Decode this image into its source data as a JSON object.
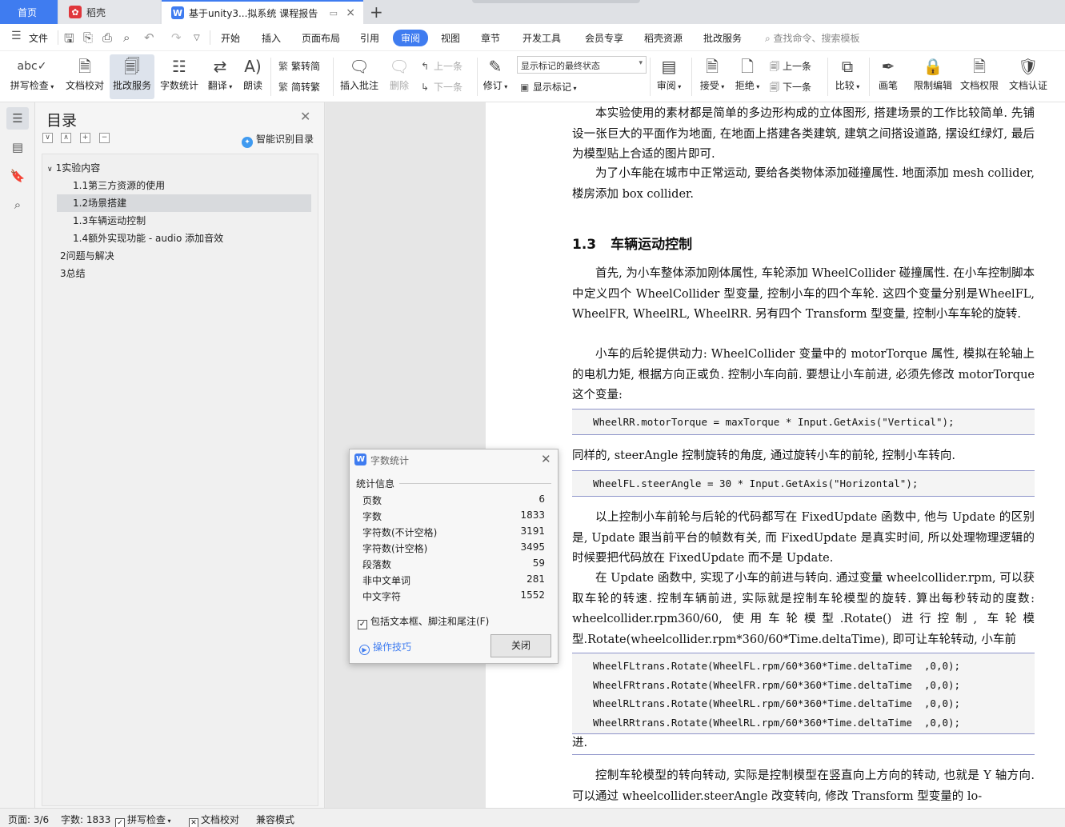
{
  "tabs": {
    "home": "首页",
    "daoke": "稻壳",
    "doc": "基于unity3...拟系统 课程报告",
    "doc_icon": "W",
    "close": "×",
    "new": "+"
  },
  "menu": {
    "file": "文件",
    "items": [
      "开始",
      "插入",
      "页面布局",
      "引用",
      "审阅",
      "视图",
      "章节",
      "开发工具",
      "会员专享",
      "稻壳资源",
      "批改服务"
    ],
    "search_placeholder": "查找命令、搜索模板"
  },
  "ribbon": {
    "spellcheck": "拼写检查",
    "doc_proof": "文档校对",
    "correction": "批改服务",
    "word_count": "字数统计",
    "translate": "翻译",
    "read_aloud": "朗读",
    "trad_to_simp": "繁转简",
    "simp_to_trad": "简转繁",
    "insert_comment": "插入批注",
    "delete": "删除",
    "prev": "上一条",
    "next": "下一条",
    "revise": "修订",
    "markup_select": "显示标记的最终状态",
    "show_markup": "显示标记",
    "review": "审阅",
    "accept": "接受",
    "reject": "拒绝",
    "prev2": "上一条",
    "next2": "下一条",
    "compare": "比较",
    "pen": "画笔",
    "restrict_edit": "限制编辑",
    "doc_rights": "文档权限",
    "doc_auth": "文档认证"
  },
  "toc": {
    "title": "目录",
    "smart": "智能识别目录",
    "items": [
      {
        "label": "1实验内容",
        "expander": "∨"
      },
      {
        "label": "1.1第三方资源的使用"
      },
      {
        "label": "1.2场景搭建"
      },
      {
        "label": "1.3车辆运动控制"
      },
      {
        "label": "1.4额外实现功能 - audio 添加音效"
      },
      {
        "label": "2问题与解决"
      },
      {
        "label": "3总结"
      }
    ]
  },
  "document": {
    "p1": "本实验使用的素材都是简单的多边形构成的立体图形, 搭建场景的工作比较简单. 先铺设一张巨大的平面作为地面, 在地面上搭建各类建筑, 建筑之间搭设道路, 摆设红绿灯, 最后为模型贴上合适的图片即可.",
    "p2": "为了小车能在城市中正常运动, 要给各类物体添加碰撞属性. 地面添加 mesh collider, 楼房添加 box collider.",
    "h13_num": "1.3",
    "h13_text": "车辆运动控制",
    "p3": "首先, 为小车整体添加刚体属性, 车轮添加 WheelCollider 碰撞属性. 在小车控制脚本中定义四个 WheelCollider 型变量, 控制小车的四个车轮. 这四个变量分别是WheelFL, WheelFR, WheelRL, WheelRR. 另有四个 Transform 型变量, 控制小车车轮的旋转.",
    "p4": "小车的后轮提供动力: WheelCollider 变量中的 motorTorque 属性, 模拟在轮轴上的电机力矩, 根据方向正或负. 控制小车向前. 要想让小车前进, 必须先修改 motorTorque 这个变量:",
    "code1": "WheelRR.motorTorque = maxTorque * Input.GetAxis(\"Vertical\");",
    "p5": "同样的, steerAngle 控制旋转的角度, 通过旋转小车的前轮, 控制小车转向.",
    "code2": "WheelFL.steerAngle = 30 * Input.GetAxis(\"Horizontal\");",
    "p6": "以上控制小车前轮与后轮的代码都写在 FixedUpdate 函数中, 他与 Update 的区别是, Update 跟当前平台的帧数有关, 而 FixedUpdate 是真实时间, 所以处理物理逻辑的时候要把代码放在 FixedUpdate 而不是 Update.",
    "p7": "在 Update 函数中, 实现了小车的前进与转向. 通过变量 wheelcollider.rpm, 可以获取车轮的转速. 控制车辆前进, 实际就是控制车轮模型的旋转. 算出每秒转动的度数: wheelcollider.rpm360/60, 使用车轮模型.Rotate() 进行控制, 车轮模型.Rotate(wheelcollider.rpm*360/60*Time.deltaTime), 即可让车轮转动, 小车前",
    "code3": [
      "WheelFLtrans.Rotate(WheelFL.rpm/60*360*Time.deltaTime  ,0,0);",
      "WheelFRtrans.Rotate(WheelFR.rpm/60*360*Time.deltaTime  ,0,0);",
      "WheelRLtrans.Rotate(WheelRL.rpm/60*360*Time.deltaTime  ,0,0);",
      "WheelRRtrans.Rotate(WheelRL.rpm/60*360*Time.deltaTime  ,0,0);"
    ],
    "p8": "进.",
    "p9": "控制车轮模型的转向转动, 实际是控制模型在竖直向上方向的转动, 也就是 Y 轴方向. 可以通过 wheelcollider.steerAngle 改变转向, 修改 Transform 型变量的 lo-"
  },
  "dialog": {
    "icon": "W",
    "title": "字数统计",
    "section": "统计信息",
    "stats": [
      {
        "label": "页数",
        "value": "6"
      },
      {
        "label": "字数",
        "value": "1833"
      },
      {
        "label": "字符数(不计空格)",
        "value": "3191"
      },
      {
        "label": "字符数(计空格)",
        "value": "3495"
      },
      {
        "label": "段落数",
        "value": "59"
      },
      {
        "label": "非中文单词",
        "value": "281"
      },
      {
        "label": "中文字符",
        "value": "1552"
      }
    ],
    "include_check": "包括文本框、脚注和尾注(F)",
    "tips": "操作技巧",
    "close_button": "关闭"
  },
  "status": {
    "page": "页面: 3/6",
    "words": "字数: 1833",
    "spell": "拼写检查",
    "proof": "文档校对",
    "compat": "兼容模式"
  },
  "colors": {
    "accent": "#3f7cf0",
    "code_rule": "#8d93c9"
  }
}
